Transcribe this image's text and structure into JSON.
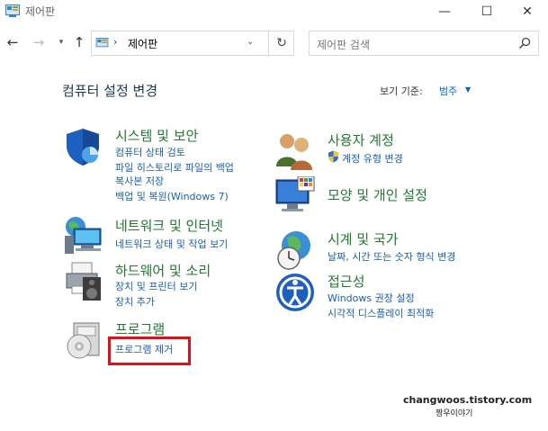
{
  "window": {
    "title": "제어판",
    "min_glyph": "—",
    "max_glyph": "☐",
    "close_glyph": "✕"
  },
  "nav": {
    "back_glyph": "←",
    "forward_glyph": "→",
    "recent_glyph": "▾",
    "up_glyph": "↑",
    "address_sep": "›",
    "address_text": "제어판",
    "address_drop": "⌄",
    "refresh_glyph": "↻",
    "search_placeholder": "제어판 검색"
  },
  "main": {
    "heading": "컴퓨터 설정 변경",
    "view_by_label": "보기 기준:",
    "view_by_value": "범주",
    "view_by_caret": "▼"
  },
  "categories": {
    "system": {
      "icon": "shield-icon",
      "title": "시스템 및 보안",
      "links": [
        "컴퓨터 상태 검토",
        "파일 히스토리로 파일의 백업",
        "복사본 저장",
        "백업 및 복원(Windows 7)"
      ]
    },
    "network": {
      "icon": "network-globe-icon",
      "title": "네트워크 및 인터넷",
      "links": [
        "네트워크 상태 및 작업 보기"
      ]
    },
    "hardware": {
      "icon": "printer-speaker-icon",
      "title": "하드웨어 및 소리",
      "links": [
        "장치 및 프린터 보기",
        "장치 추가"
      ]
    },
    "programs": {
      "icon": "program-disc-icon",
      "title": "프로그램",
      "links": [
        "프로그램 제거"
      ]
    },
    "users": {
      "icon": "users-icon",
      "title": "사용자 계정",
      "links": [
        "계정 유형 변경"
      ]
    },
    "appearance": {
      "icon": "monitor-palette-icon",
      "title": "모양 및 개인 설정",
      "links": []
    },
    "clock": {
      "icon": "clock-globe-icon",
      "title": "시계 및 국가",
      "links": [
        "날짜, 시간 또는 숫자 형식 변경"
      ]
    },
    "access": {
      "icon": "accessibility-icon",
      "title": "접근성",
      "links": [
        "Windows 권장 설정",
        "시각적 디스플레이 최적화"
      ]
    }
  },
  "watermark": {
    "line1": "changwoos.tistory.com",
    "line2": "짱우이야기"
  },
  "colors": {
    "category_title": "#1f7a2e",
    "link": "#1a5fb4",
    "highlight": "#e0101a"
  }
}
